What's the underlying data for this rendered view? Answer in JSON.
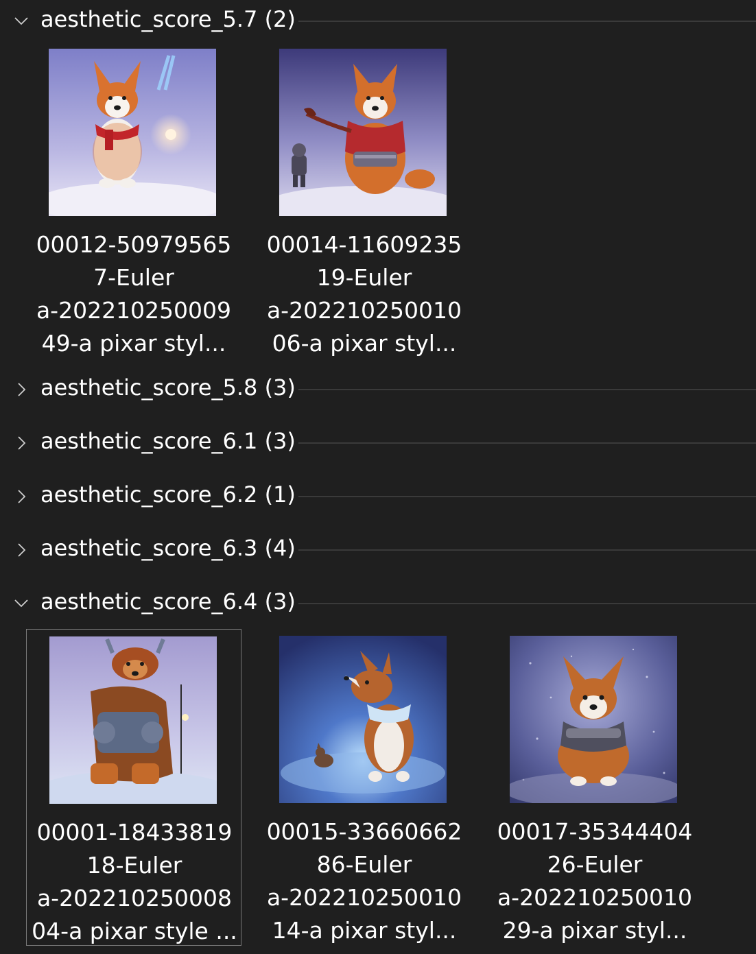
{
  "groups": [
    {
      "title": "aesthetic_score_5.7 (2)",
      "expanded": true,
      "items": [
        {
          "lines": [
            "00012-50979565",
            "7-Euler",
            "a-202210250009",
            "49-a pixar styl..."
          ],
          "thumb": "corgi-red-scarf-snow-lamp"
        },
        {
          "lines": [
            "00014-11609235",
            "19-Euler",
            "a-202210250010",
            "06-a pixar styl..."
          ],
          "thumb": "corgi-red-jacket-with-knight"
        }
      ]
    },
    {
      "title": "aesthetic_score_5.8 (3)",
      "expanded": false
    },
    {
      "title": "aesthetic_score_6.1 (3)",
      "expanded": false
    },
    {
      "title": "aesthetic_score_6.2 (1)",
      "expanded": false
    },
    {
      "title": "aesthetic_score_6.3 (4)",
      "expanded": false
    },
    {
      "title": "aesthetic_score_6.4 (3)",
      "expanded": true,
      "items": [
        {
          "lines": [
            "00001-18433819",
            "18-Euler",
            "a-202210250008",
            "04-a pixar style ..."
          ],
          "thumb": "corgi-armored-warrior",
          "selected": true
        },
        {
          "lines": [
            "00015-33660662",
            "86-Euler",
            "a-202210250010",
            "14-a pixar styl..."
          ],
          "thumb": "corgi-blue-scarf-small-fox"
        },
        {
          "lines": [
            "00017-35344404",
            "26-Euler",
            "a-202210250010",
            "29-a pixar styl..."
          ],
          "thumb": "corgi-armor-snowfall"
        }
      ]
    }
  ],
  "icons": {
    "expanded": "chevron-down-icon",
    "collapsed": "chevron-right-icon"
  },
  "colors": {
    "background": "#1f1f1f",
    "divider": "#3a3a3a",
    "selection_border": "#7a7a7a",
    "text": "#ffffff"
  }
}
